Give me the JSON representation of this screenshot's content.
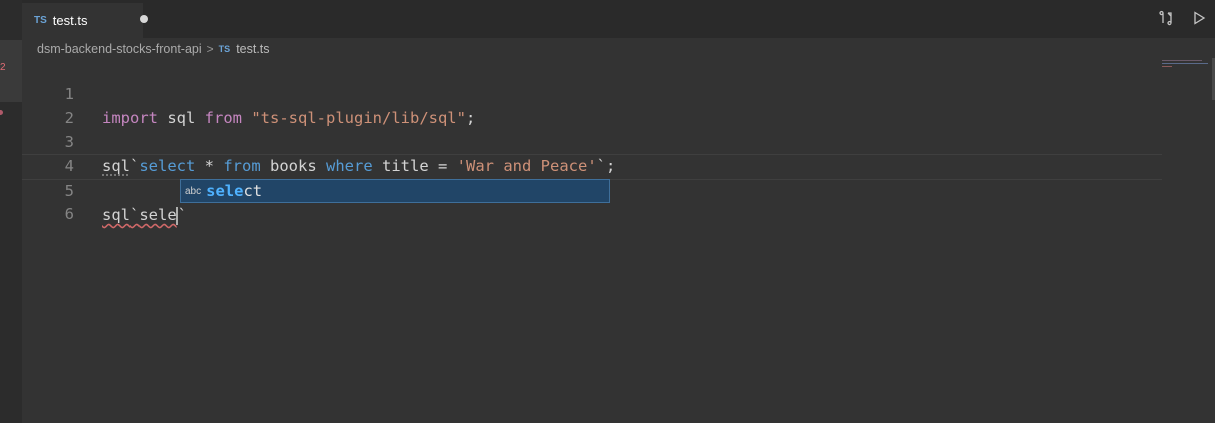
{
  "tab": {
    "lang_badge": "TS",
    "filename": "test.ts"
  },
  "breadcrumb": {
    "folder": "dsm-backend-stocks-front-api",
    "separator": ">",
    "lang_badge": "TS",
    "file": "test.ts"
  },
  "activity": {
    "badge": "2"
  },
  "editor": {
    "lines": [
      {
        "number": "1"
      },
      {
        "number": "2"
      },
      {
        "number": "3"
      },
      {
        "number": "4"
      },
      {
        "number": "5"
      },
      {
        "number": "6"
      }
    ],
    "line1": {
      "kw_import": "import",
      "ident": " sql ",
      "kw_from": "from",
      "space": " ",
      "string": "\"ts-sql-plugin/lib/sql\"",
      "semi": ";"
    },
    "line3": {
      "tag": "sql",
      "tick": "`",
      "select": "select",
      "star": " * ",
      "from": "from",
      "books": " books ",
      "where": "where",
      "cond": " title = ",
      "value": "'War and Peace'",
      "end": "`;"
    },
    "line5": {
      "tag": "sql",
      "tick": "`",
      "partial": "sele",
      "end_tick": "`"
    }
  },
  "suggest": {
    "kind": "abc",
    "match": "sele",
    "rest": "ct"
  },
  "colors": {
    "keyword": "#c586c0",
    "string": "#ce9178",
    "sql_keyword": "#569cd6",
    "suggest_bg": "#214567",
    "suggest_match": "#4fb2ff"
  }
}
